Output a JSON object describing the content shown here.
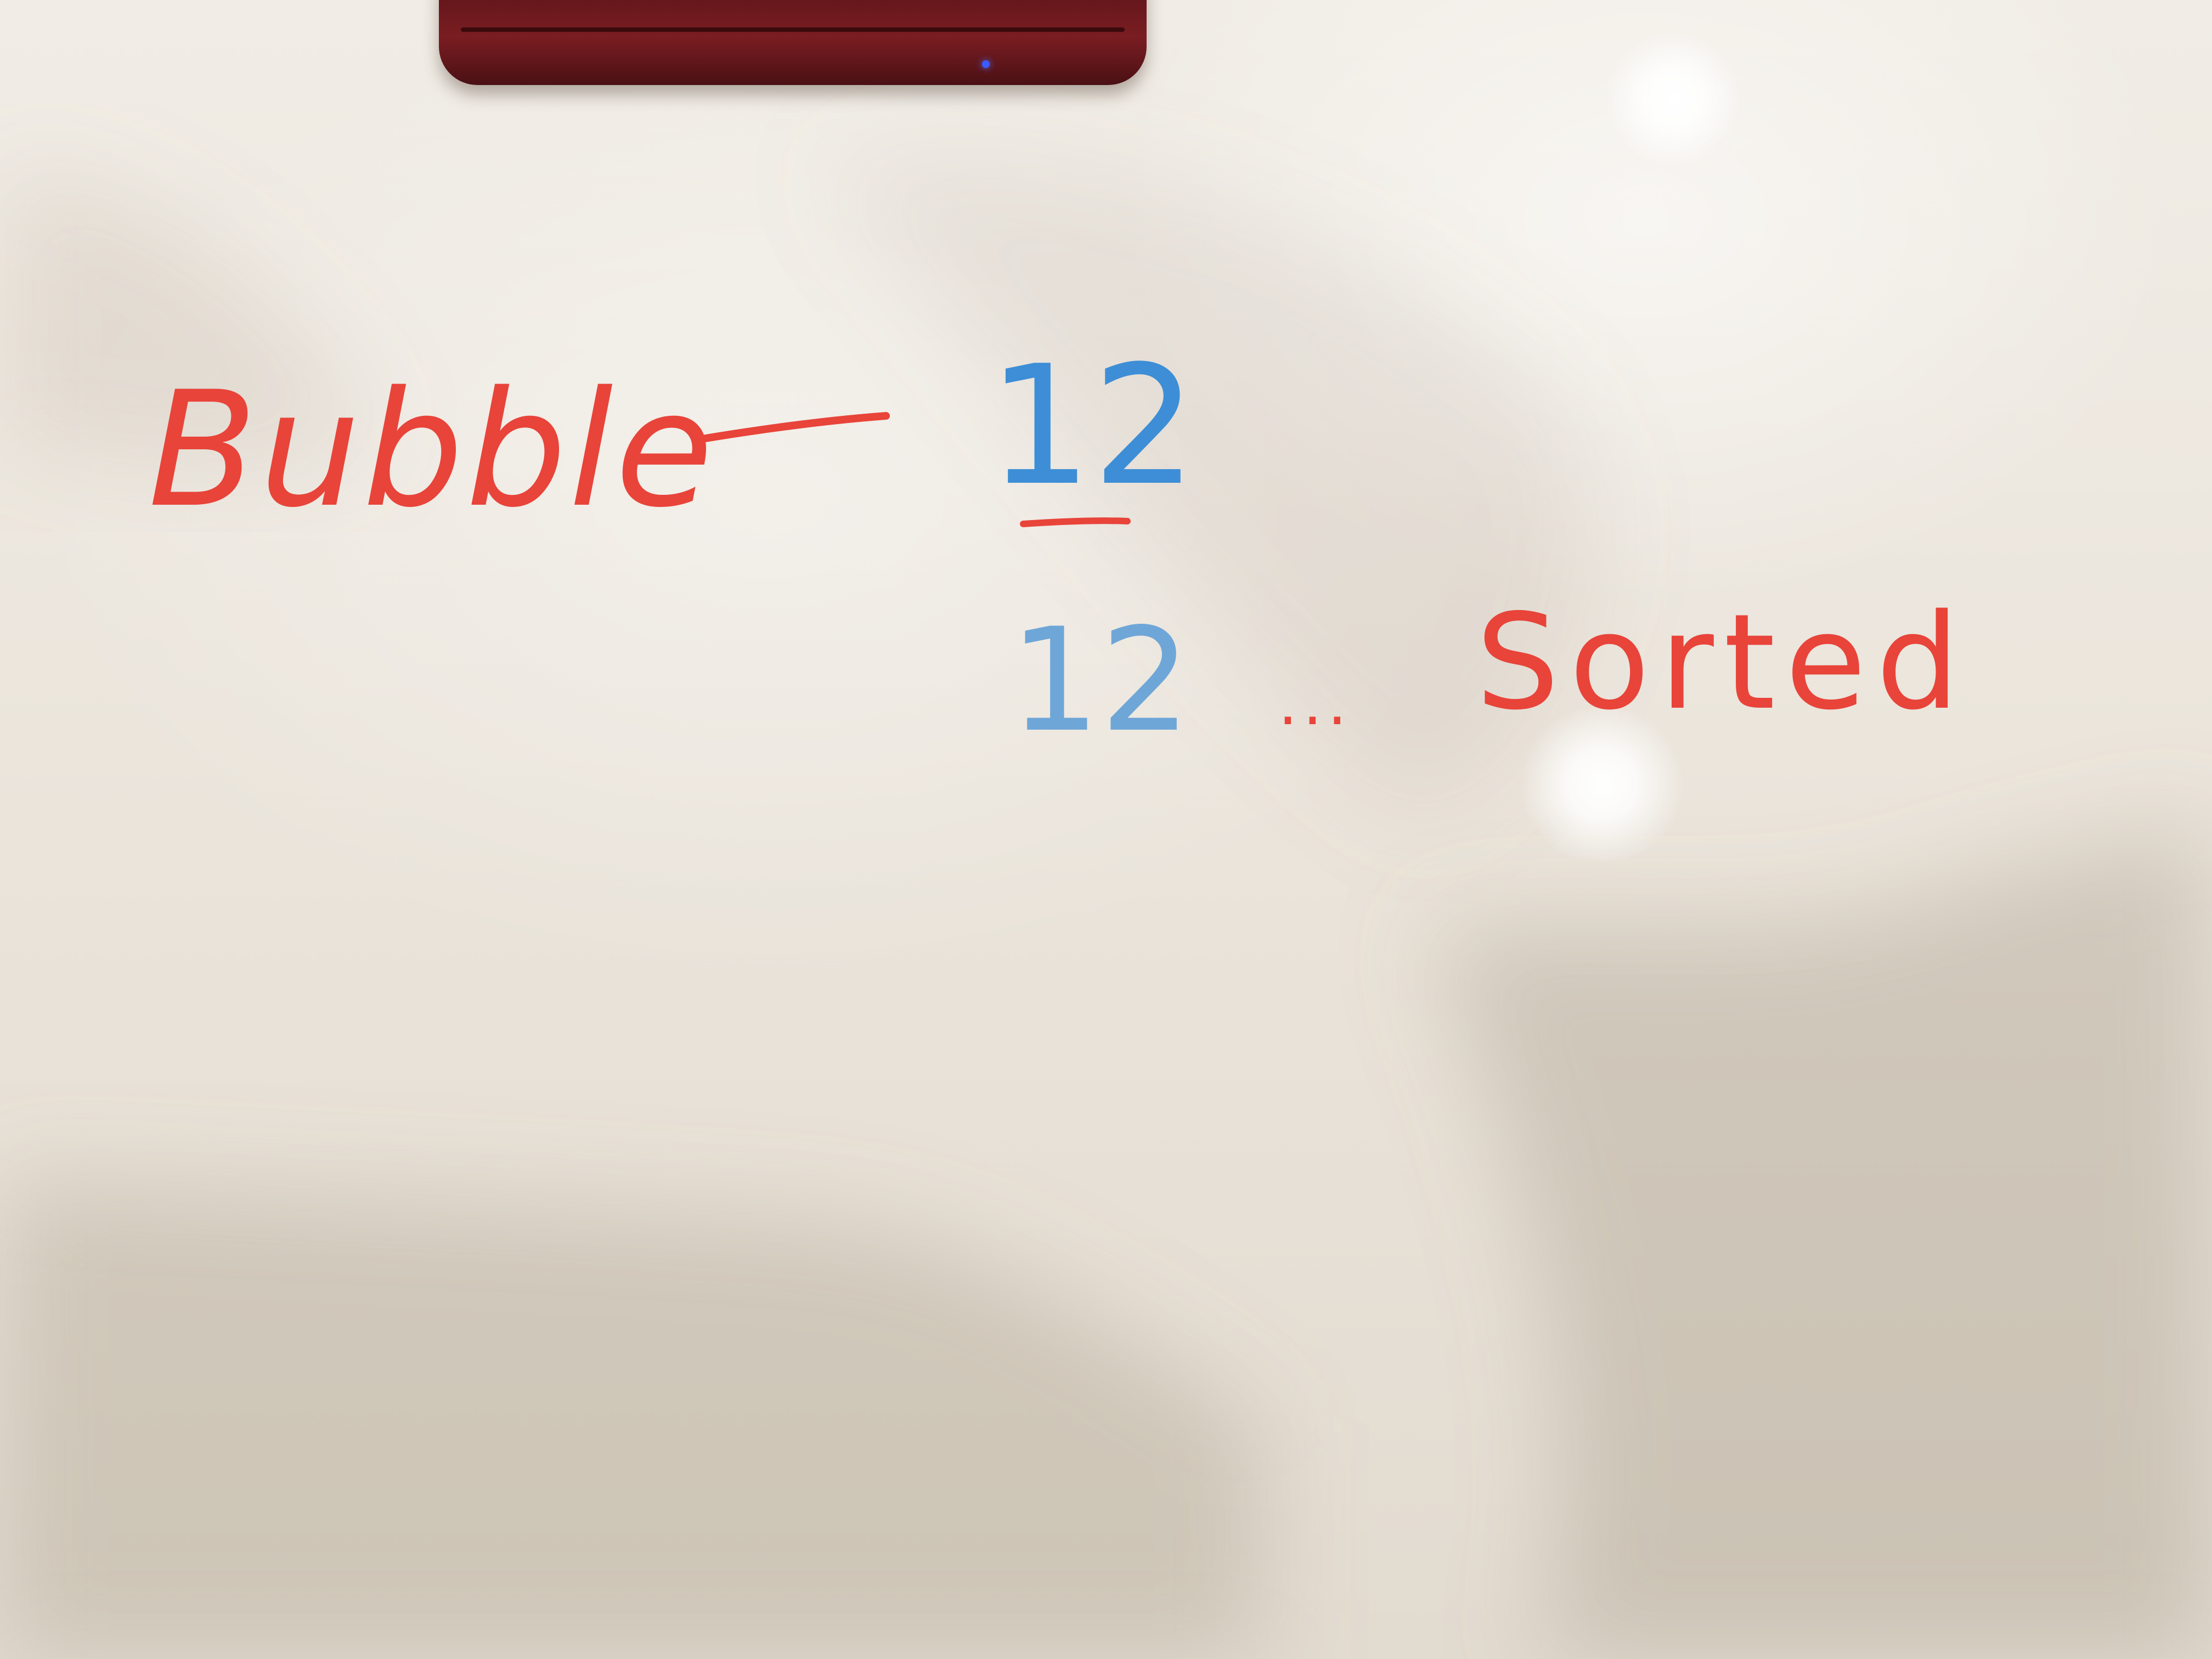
{
  "whiteboard": {
    "word_bubble": "Bubble",
    "number_top": "12",
    "number_bottom": "12",
    "ellipsis": "...",
    "word_sorted": "Sorted"
  },
  "colors": {
    "red_marker": "#e8443a",
    "blue_marker": "#3d8ed6",
    "board": "#ece6dd",
    "device_body": "#6e1a1f",
    "device_led": "#3b5bff"
  },
  "icons": {
    "device": "red-handheld-device"
  }
}
